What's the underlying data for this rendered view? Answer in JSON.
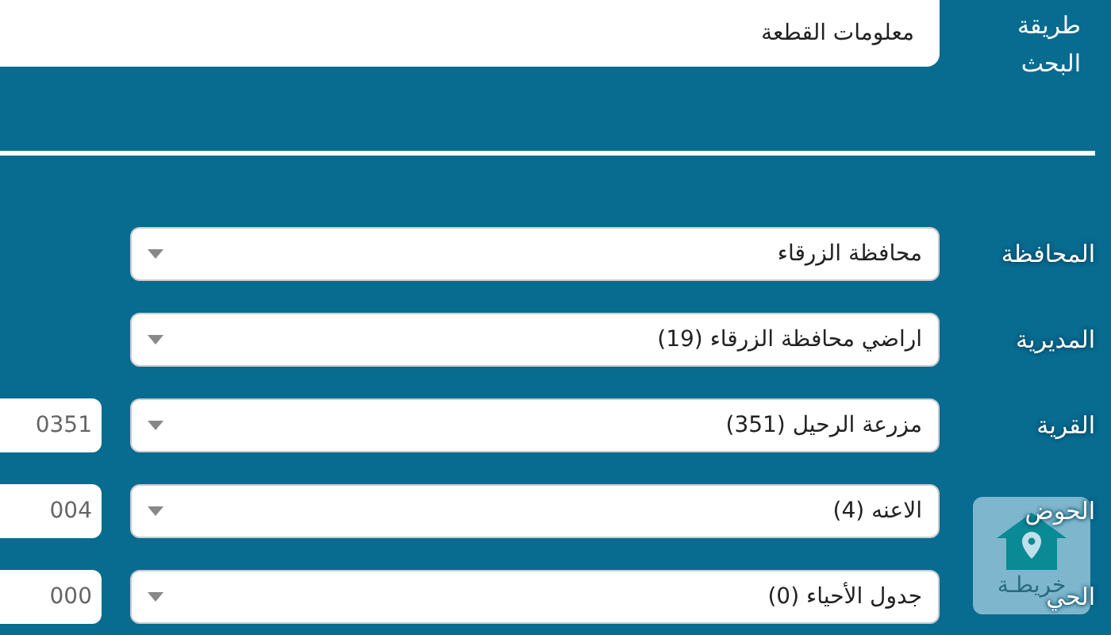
{
  "search_method": {
    "label": "طريقة البحث",
    "value": "معلومات القطعة"
  },
  "rows": [
    {
      "label": "المحافظة",
      "value": "محافظة الزرقاء"
    },
    {
      "label": "المديرية",
      "value": "اراضي محافظة الزرقاء (19)"
    },
    {
      "label": "القرية",
      "value": "مزرعة الرحيل (351)",
      "code": "0351"
    },
    {
      "label": "الحوض",
      "value": "الاعنه (4)",
      "code": "004"
    },
    {
      "label": "الحي",
      "value": "جدول الأحياء (0)",
      "code": "000"
    }
  ],
  "map_button": {
    "label": "خريطـة"
  }
}
